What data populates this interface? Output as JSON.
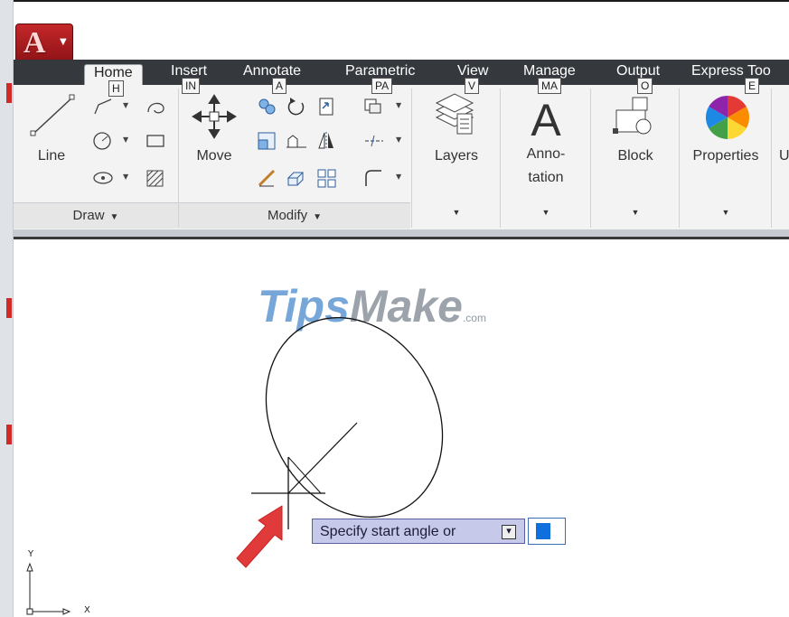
{
  "app": {
    "button_glyph": "A",
    "accent": "#c4272a"
  },
  "tabs": [
    {
      "label": "Home",
      "keytip": "H",
      "active": true
    },
    {
      "label": "Insert",
      "keytip": "IN"
    },
    {
      "label": "Annotate",
      "keytip": "A"
    },
    {
      "label": "Parametric",
      "keytip": "PA"
    },
    {
      "label": "View",
      "keytip": "V"
    },
    {
      "label": "Manage",
      "keytip": "MA"
    },
    {
      "label": "Output",
      "keytip": "O"
    },
    {
      "label": "Express Too",
      "keytip": "E"
    }
  ],
  "ribbon": {
    "draw": {
      "title": "Draw",
      "line_label": "Line",
      "tools": [
        "polyline-icon",
        "circle-icon",
        "arc-icon",
        "ellipse-icon",
        "rectangle-icon",
        "hatch-icon"
      ]
    },
    "modify": {
      "title": "Modify",
      "move_label": "Move",
      "tools": [
        "copy-icon",
        "rotate-icon",
        "trim-icon",
        "stretch-icon",
        "scale-icon",
        "mirror-icon",
        "fillet-icon",
        "array-icon",
        "explode-icon",
        "erase-icon",
        "offset-icon",
        "chamfer-icon"
      ]
    },
    "layers": {
      "label": "Layers"
    },
    "annotation": {
      "label_line1": "Anno-",
      "label_line2": "tation"
    },
    "block": {
      "label": "Block"
    },
    "properties": {
      "label": "Properties"
    }
  },
  "canvas": {
    "watermark_main": "Tips",
    "watermark_main2": "Make",
    "watermark_suffix": ".com",
    "tooltip_text": "Specify start angle or",
    "ucs_x": "X",
    "ucs_y": "Y"
  }
}
